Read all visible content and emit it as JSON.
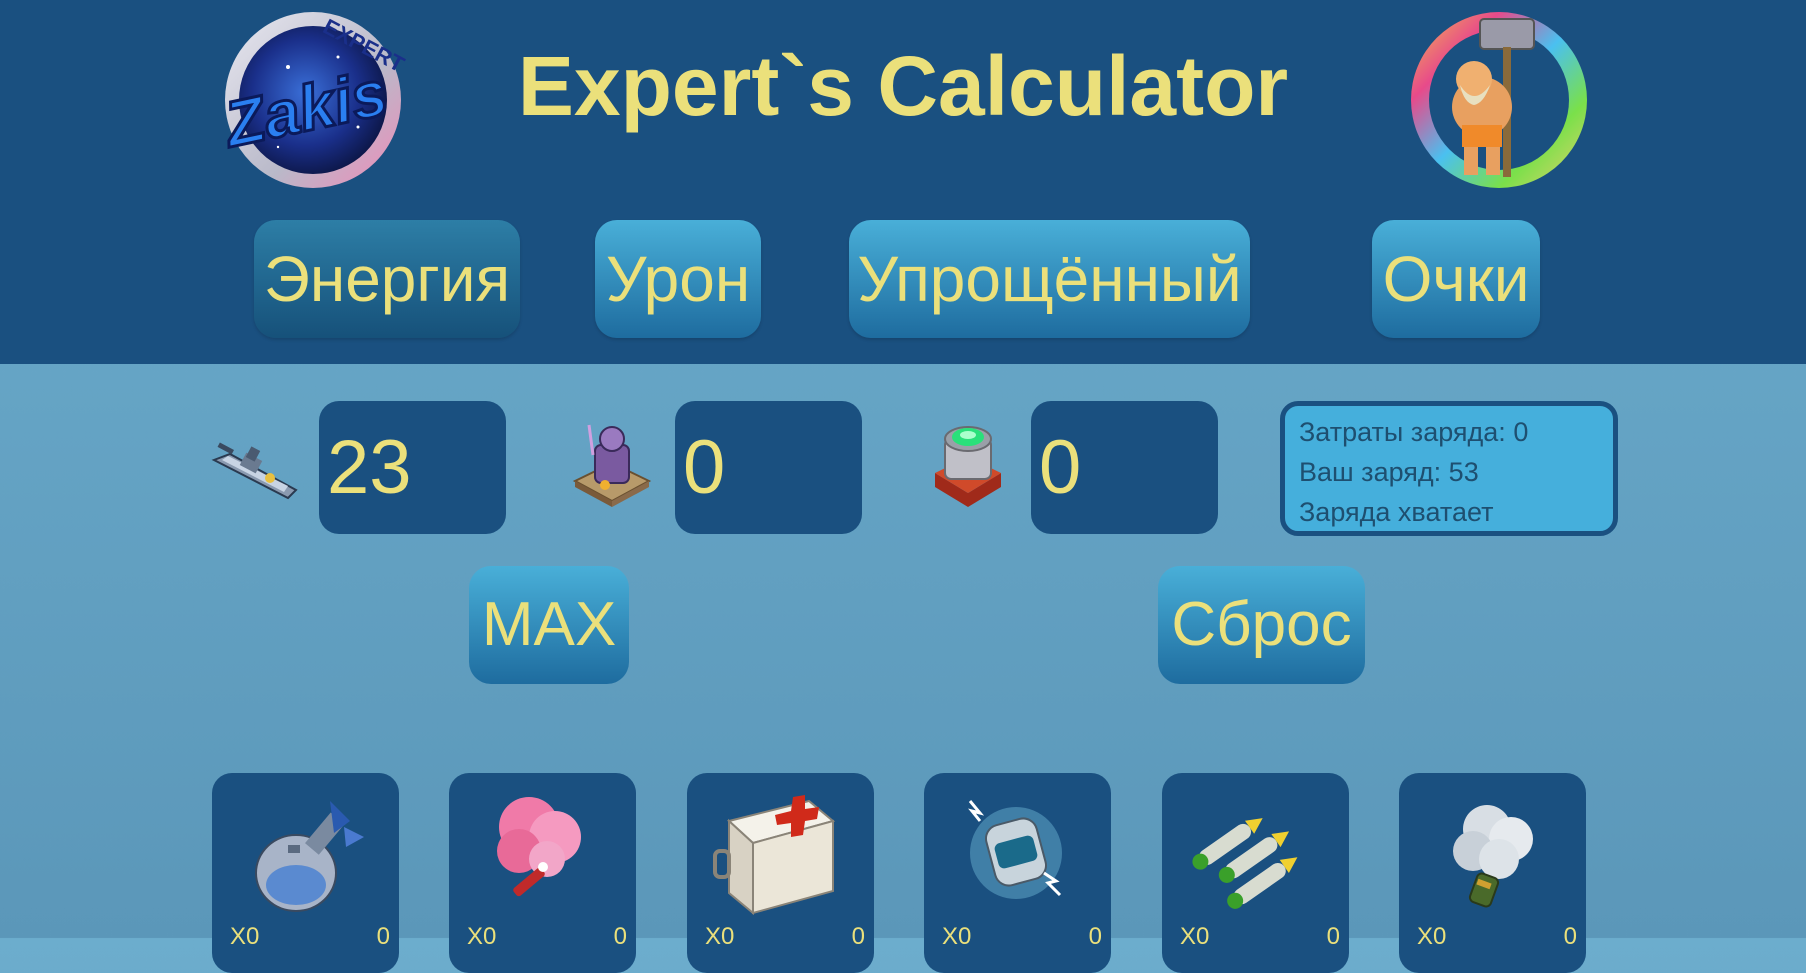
{
  "header": {
    "title": "Expert`s Calculator",
    "logo_left_text": "Zakis",
    "logo_left_ring_text": "EXPERT"
  },
  "tabs": [
    {
      "label": "Энергия",
      "active": true
    },
    {
      "label": "Урон",
      "active": false
    },
    {
      "label": "Упрощённый",
      "active": false
    },
    {
      "label": "Очки",
      "active": false
    }
  ],
  "inputs": [
    {
      "icon": "gunboat-icon",
      "value": "23"
    },
    {
      "icon": "statue-icon",
      "value": "0"
    },
    {
      "icon": "power-core-icon",
      "value": "0"
    }
  ],
  "info": {
    "cost": "Затраты заряда: 0",
    "charge": "Ваш заряд: 53",
    "status": "Заряда хватает"
  },
  "actions": {
    "max_label": "MAX",
    "reset_label": "Сброс"
  },
  "items": [
    {
      "icon": "bomb-icon",
      "prefix": "X0",
      "count": "0"
    },
    {
      "icon": "smoke-flare-icon",
      "prefix": "X0",
      "count": "0"
    },
    {
      "icon": "medkit-icon",
      "prefix": "X0",
      "count": "0"
    },
    {
      "icon": "shock-bomb-icon",
      "prefix": "X0",
      "count": "0"
    },
    {
      "icon": "barrage-icon",
      "prefix": "X0",
      "count": "0"
    },
    {
      "icon": "smoke-screen-icon",
      "prefix": "X0",
      "count": "0"
    }
  ],
  "colors": {
    "header_bg": "#1a5080",
    "accent_text": "#ebe07b",
    "button_top": "#49afd8",
    "button_bottom": "#1e6c9f",
    "info_bg": "#45afdc"
  }
}
